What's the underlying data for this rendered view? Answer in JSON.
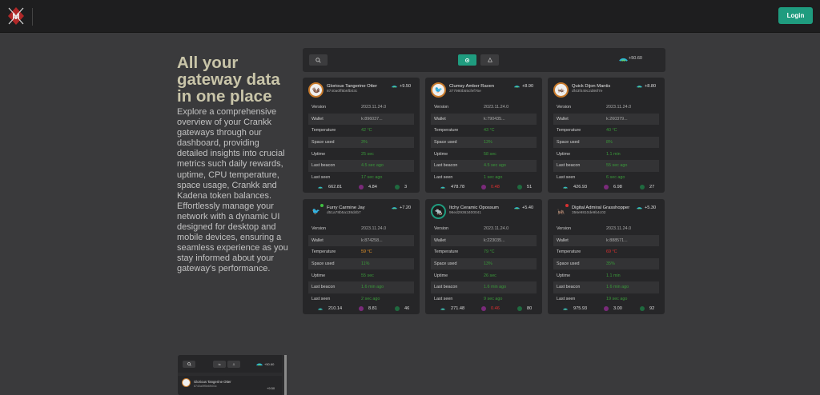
{
  "header": {
    "login_label": "Login"
  },
  "hero": {
    "title": "All your gateway data in one place",
    "description": "Explore a comprehensive overview of your Crankk gateways through our dashboard, providing detailed insights into crucial metrics such daily rewards, uptime, CPU temperature, space usage, Crankk and Kadena token balances. Effortlessly manage your network with a dynamic UI designed for desktop and mobile devices, ensuring a seamless experience as you stay informed about your gateway's performance."
  },
  "toolbar": {
    "total_reward": "+50.60",
    "icons": [
      "search-icon",
      "grid-view-icon",
      "list-view-icon",
      "crankk-token-icon"
    ]
  },
  "row_labels": [
    "Version",
    "Wallet",
    "Temperature",
    "Space used",
    "Uptime",
    "Last beacon",
    "Last seen"
  ],
  "cards": [
    {
      "name": "Glorious Tangerine Otter",
      "id": "8740a0ff5b6fb03c",
      "reward": "+9.50",
      "values": [
        "2023.11.24.0",
        "k:896037...",
        "42 °C",
        "3%",
        "25 sec",
        "4.5 sec ago",
        "17 sec ago"
      ],
      "value_colors": [
        "gray",
        "gray",
        "green",
        "green",
        "green",
        "green",
        "green"
      ],
      "crankk": "662.81",
      "kadena": "4.84",
      "count": "3",
      "kadena_color": "normal"
    },
    {
      "name": "Clumsy Amber Raven",
      "id": "377980b55cfef76e",
      "reward": "+8.90",
      "values": [
        "2023.11.24.0",
        "k:790435...",
        "43 °C",
        "13%",
        "58 sec",
        "4.5 sec ago",
        "1 sec ago"
      ],
      "value_colors": [
        "gray",
        "gray",
        "green",
        "green",
        "green",
        "green",
        "green"
      ],
      "crankk": "478.78",
      "kadena": "0.48",
      "count": "51",
      "kadena_color": "red"
    },
    {
      "name": "Quick Dijon Mantis",
      "id": "df43f449c2d86f7e",
      "reward": "+8.80",
      "values": [
        "2023.11.24.0",
        "k:260379...",
        "40 °C",
        "8%",
        "1.1 min",
        "55 sec ago",
        "6 sec ago"
      ],
      "value_colors": [
        "gray",
        "gray",
        "green",
        "green",
        "green",
        "green",
        "green"
      ],
      "crankk": "426.93",
      "kadena": "6.98",
      "count": "27",
      "kadena_color": "normal"
    },
    {
      "name": "Furry Carmine Jay",
      "id": "d51a78b5a138d4b7",
      "reward": "+7.20",
      "values": [
        "2023.11.24.0",
        "k:874258...",
        "59 °C",
        "11%",
        "55 sec",
        "1.6 min ago",
        "2 sec ago"
      ],
      "value_colors": [
        "gray",
        "gray",
        "orange",
        "green",
        "green",
        "green",
        "green"
      ],
      "crankk": "210.14",
      "kadena": "8.81",
      "count": "46",
      "kadena_color": "normal"
    },
    {
      "name": "Itchy Ceramic Opossum",
      "id": "96ed29363400041",
      "reward": "+5.40",
      "values": [
        "2023.11.24.0",
        "k:223035...",
        "79 °C",
        "13%",
        "26 sec",
        "1.6 min ago",
        "9 sec ago"
      ],
      "value_colors": [
        "gray",
        "gray",
        "green",
        "green",
        "green",
        "green",
        "green"
      ],
      "crankk": "271.48",
      "kadena": "0.46",
      "count": "80",
      "kadena_color": "red"
    },
    {
      "name": "Digital Admiral Grasshopper",
      "id": "356e9810de9b4c02",
      "reward": "+5.30",
      "values": [
        "2023.11.24.0",
        "k:888571...",
        "69 °C",
        "35%",
        "1.1 min",
        "1.6 min ago",
        "19 sec ago"
      ],
      "value_colors": [
        "gray",
        "gray",
        "red",
        "green",
        "green",
        "green",
        "green"
      ],
      "crankk": "975.93",
      "kadena": "3.00",
      "count": "92",
      "kadena_color": "normal"
    }
  ],
  "mini_preview": {
    "total_reward": "+50.60",
    "card_name": "Glorious Tangerine Otter",
    "card_id": "8740a0ff5b6fb03c",
    "card_reward": "+9.50"
  },
  "colors": {
    "accent": "#1f9c7f",
    "background": "#3a3a3c",
    "card": "#262628",
    "title": "#c9c5a9",
    "ok": "#3a9a3a",
    "warn": "#e8962a",
    "bad": "#e03030"
  }
}
